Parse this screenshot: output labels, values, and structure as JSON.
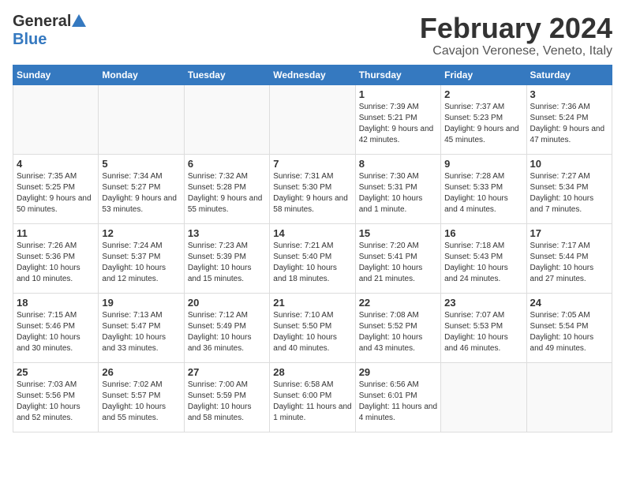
{
  "header": {
    "logo_general": "General",
    "logo_blue": "Blue",
    "month_title": "February 2024",
    "subtitle": "Cavajon Veronese, Veneto, Italy"
  },
  "weekdays": [
    "Sunday",
    "Monday",
    "Tuesday",
    "Wednesday",
    "Thursday",
    "Friday",
    "Saturday"
  ],
  "weeks": [
    [
      {
        "num": "",
        "info": ""
      },
      {
        "num": "",
        "info": ""
      },
      {
        "num": "",
        "info": ""
      },
      {
        "num": "",
        "info": ""
      },
      {
        "num": "1",
        "info": "Sunrise: 7:39 AM\nSunset: 5:21 PM\nDaylight: 9 hours and 42 minutes."
      },
      {
        "num": "2",
        "info": "Sunrise: 7:37 AM\nSunset: 5:23 PM\nDaylight: 9 hours and 45 minutes."
      },
      {
        "num": "3",
        "info": "Sunrise: 7:36 AM\nSunset: 5:24 PM\nDaylight: 9 hours and 47 minutes."
      }
    ],
    [
      {
        "num": "4",
        "info": "Sunrise: 7:35 AM\nSunset: 5:25 PM\nDaylight: 9 hours and 50 minutes."
      },
      {
        "num": "5",
        "info": "Sunrise: 7:34 AM\nSunset: 5:27 PM\nDaylight: 9 hours and 53 minutes."
      },
      {
        "num": "6",
        "info": "Sunrise: 7:32 AM\nSunset: 5:28 PM\nDaylight: 9 hours and 55 minutes."
      },
      {
        "num": "7",
        "info": "Sunrise: 7:31 AM\nSunset: 5:30 PM\nDaylight: 9 hours and 58 minutes."
      },
      {
        "num": "8",
        "info": "Sunrise: 7:30 AM\nSunset: 5:31 PM\nDaylight: 10 hours and 1 minute."
      },
      {
        "num": "9",
        "info": "Sunrise: 7:28 AM\nSunset: 5:33 PM\nDaylight: 10 hours and 4 minutes."
      },
      {
        "num": "10",
        "info": "Sunrise: 7:27 AM\nSunset: 5:34 PM\nDaylight: 10 hours and 7 minutes."
      }
    ],
    [
      {
        "num": "11",
        "info": "Sunrise: 7:26 AM\nSunset: 5:36 PM\nDaylight: 10 hours and 10 minutes."
      },
      {
        "num": "12",
        "info": "Sunrise: 7:24 AM\nSunset: 5:37 PM\nDaylight: 10 hours and 12 minutes."
      },
      {
        "num": "13",
        "info": "Sunrise: 7:23 AM\nSunset: 5:39 PM\nDaylight: 10 hours and 15 minutes."
      },
      {
        "num": "14",
        "info": "Sunrise: 7:21 AM\nSunset: 5:40 PM\nDaylight: 10 hours and 18 minutes."
      },
      {
        "num": "15",
        "info": "Sunrise: 7:20 AM\nSunset: 5:41 PM\nDaylight: 10 hours and 21 minutes."
      },
      {
        "num": "16",
        "info": "Sunrise: 7:18 AM\nSunset: 5:43 PM\nDaylight: 10 hours and 24 minutes."
      },
      {
        "num": "17",
        "info": "Sunrise: 7:17 AM\nSunset: 5:44 PM\nDaylight: 10 hours and 27 minutes."
      }
    ],
    [
      {
        "num": "18",
        "info": "Sunrise: 7:15 AM\nSunset: 5:46 PM\nDaylight: 10 hours and 30 minutes."
      },
      {
        "num": "19",
        "info": "Sunrise: 7:13 AM\nSunset: 5:47 PM\nDaylight: 10 hours and 33 minutes."
      },
      {
        "num": "20",
        "info": "Sunrise: 7:12 AM\nSunset: 5:49 PM\nDaylight: 10 hours and 36 minutes."
      },
      {
        "num": "21",
        "info": "Sunrise: 7:10 AM\nSunset: 5:50 PM\nDaylight: 10 hours and 40 minutes."
      },
      {
        "num": "22",
        "info": "Sunrise: 7:08 AM\nSunset: 5:52 PM\nDaylight: 10 hours and 43 minutes."
      },
      {
        "num": "23",
        "info": "Sunrise: 7:07 AM\nSunset: 5:53 PM\nDaylight: 10 hours and 46 minutes."
      },
      {
        "num": "24",
        "info": "Sunrise: 7:05 AM\nSunset: 5:54 PM\nDaylight: 10 hours and 49 minutes."
      }
    ],
    [
      {
        "num": "25",
        "info": "Sunrise: 7:03 AM\nSunset: 5:56 PM\nDaylight: 10 hours and 52 minutes."
      },
      {
        "num": "26",
        "info": "Sunrise: 7:02 AM\nSunset: 5:57 PM\nDaylight: 10 hours and 55 minutes."
      },
      {
        "num": "27",
        "info": "Sunrise: 7:00 AM\nSunset: 5:59 PM\nDaylight: 10 hours and 58 minutes."
      },
      {
        "num": "28",
        "info": "Sunrise: 6:58 AM\nSunset: 6:00 PM\nDaylight: 11 hours and 1 minute."
      },
      {
        "num": "29",
        "info": "Sunrise: 6:56 AM\nSunset: 6:01 PM\nDaylight: 11 hours and 4 minutes."
      },
      {
        "num": "",
        "info": ""
      },
      {
        "num": "",
        "info": ""
      }
    ]
  ]
}
